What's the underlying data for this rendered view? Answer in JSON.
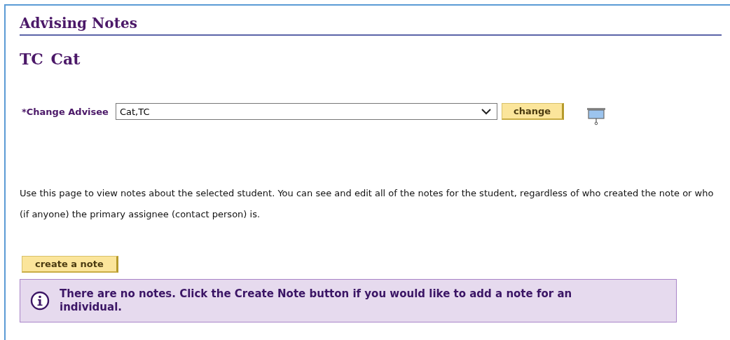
{
  "page_title": "Advising Notes",
  "student_name": "TC Cat",
  "advisee": {
    "label": "*Change Advisee",
    "value": "Cat,TC",
    "button": "change"
  },
  "description": "Use this page to view notes about the selected student. You can see and edit all of the notes for the student, regardless of who created the note or who (if anyone) the primary assignee (contact person) is.",
  "create_button": "create a note",
  "message": {
    "kind": "info",
    "text": "There are no notes. Click the Create Note button if you would like to add a note for an individual."
  }
}
